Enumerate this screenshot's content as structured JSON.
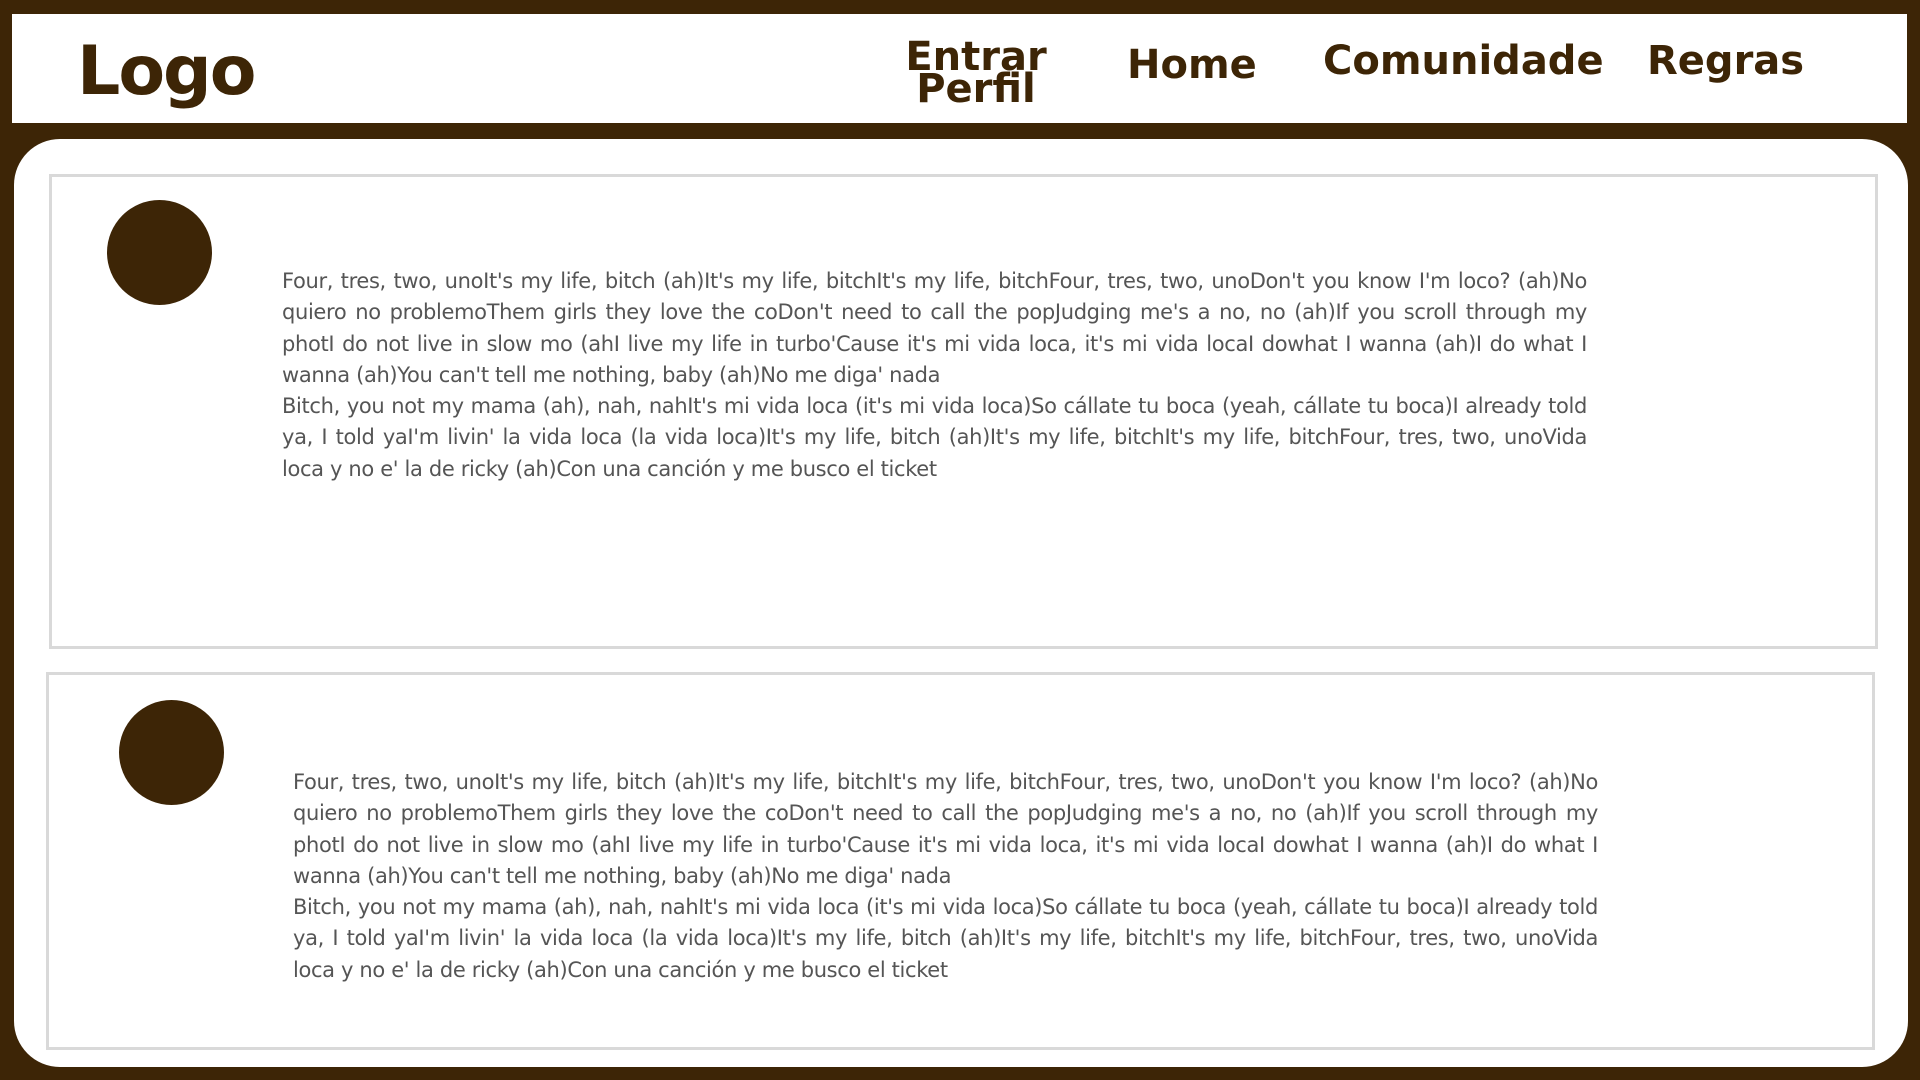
{
  "header": {
    "logo": "Logo",
    "nav": {
      "entrar": "Entrar",
      "perfil": "Perfil",
      "home": "Home",
      "comunidade": "Comunidade",
      "regras": "Regras"
    }
  },
  "colors": {
    "brand": "#3d2506",
    "background": "#ffffff",
    "post_border": "#d9d9d9",
    "text": "#555555"
  },
  "posts": [
    {
      "paragraphs": [
        "Four, tres, two, unoIt's my life, bitch (ah)It's my life, bitchIt's my life, bitchFour, tres, two, unoDon't you know I'm loco? (ah)No quiero no problemoThem girls they love the coDon't need to call the popJudging me's a no, no (ah)If you scroll through my photI do not live in slow mo (ahI live my life in turbo'Cause it's mi vida loca, it's mi vida locaI dowhat I wanna (ah)I do what I wanna (ah)You can't tell me nothing, baby (ah)No me diga' nada",
        "Bitch, you not my mama (ah), nah, nahIt's mi vida loca (it's mi vida loca)So cállate tu boca (yeah, cállate tu boca)I already told ya, I told yaI'm livin' la vida loca (la vida loca)It's my life, bitch (ah)It's my life, bitchIt's my life, bitchFour, tres, two, unoVida loca y no e' la de ricky (ah)Con una canción y me busco el ticket"
      ]
    },
    {
      "paragraphs": [
        "Four, tres, two, unoIt's my life, bitch (ah)It's my life, bitchIt's my life, bitchFour, tres, two, unoDon't you know I'm loco? (ah)No quiero no problemoThem girls they love the coDon't need to call the popJudging me's a no, no (ah)If you scroll through my photI do not live in slow mo (ahI live my life in turbo'Cause it's mi vida loca, it's mi vida locaI dowhat I wanna (ah)I do what I wanna (ah)You can't tell me nothing, baby (ah)No me diga' nada",
        "Bitch, you not my mama (ah), nah, nahIt's mi vida loca (it's mi vida loca)So cállate tu boca (yeah, cállate tu boca)I already told ya, I told yaI'm livin' la vida loca (la vida loca)It's my life, bitch (ah)It's my life, bitchIt's my life, bitchFour, tres, two, unoVida loca y no e' la de ricky (ah)Con una canción y me busco el ticket"
      ]
    }
  ]
}
